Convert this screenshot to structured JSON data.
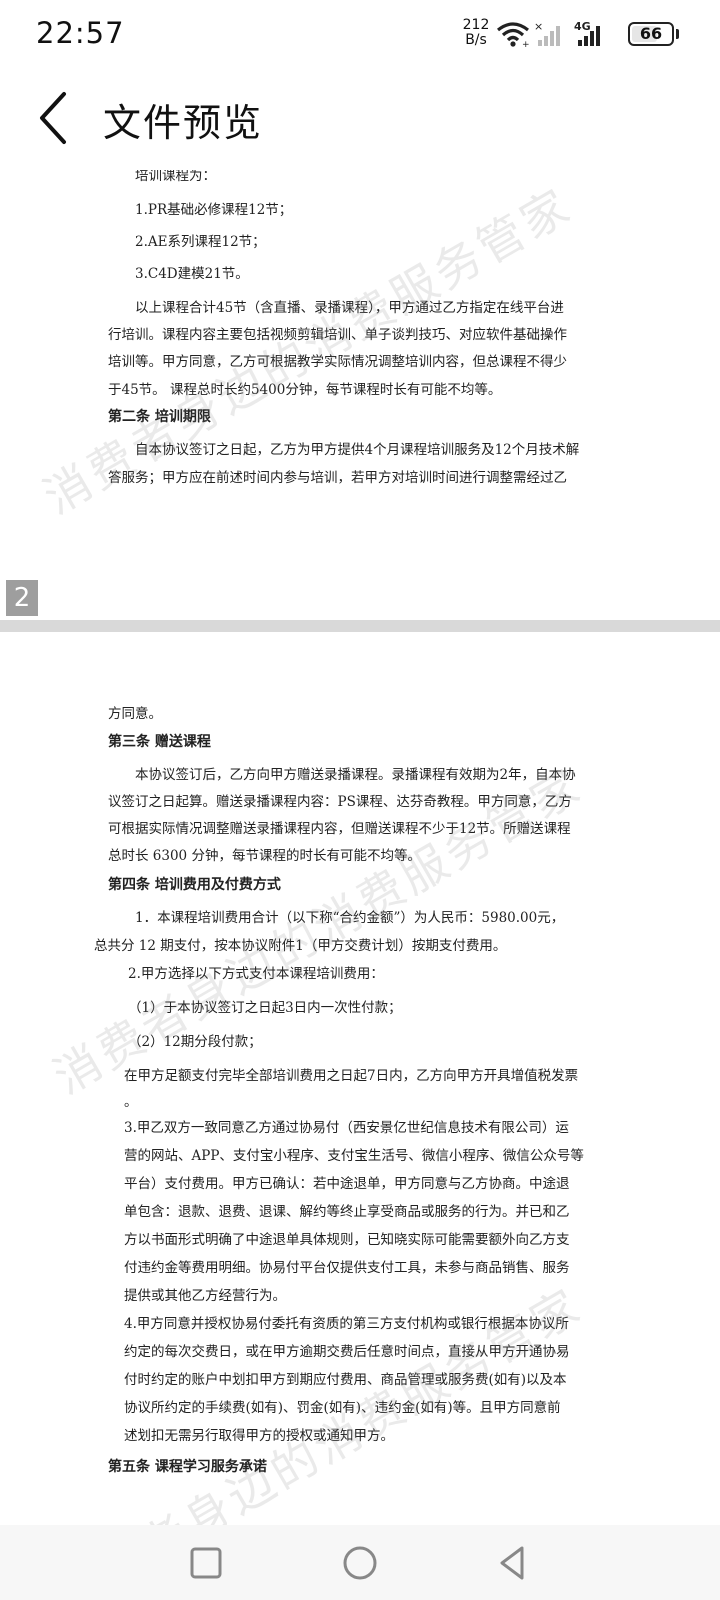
{
  "status_bar": {
    "time": "22:57",
    "net_speed_value": "212",
    "net_speed_unit": "B/s",
    "network_type": "4G",
    "battery": "66",
    "battery_level": 0.66,
    "icons": [
      "wifi-icon",
      "signal-off-icon",
      "signal-4g-icon",
      "battery-icon"
    ]
  },
  "header": {
    "title": "文件预览",
    "back_icon": "chevron-left-icon"
  },
  "viewer": {
    "page_number": "2",
    "watermark": "消费者身边的消费服务管家",
    "page1_lines": [
      "培训课程为：",
      "1.PR基础必修课程12节；",
      "2.AE系列课程12节；",
      "3.C4D建模21节。",
      "以上课程合计45节（含直播、录播课程），甲方通过乙方指定在线平台进",
      "行培训。课程内容主要包括视频剪辑培训、单子谈判技巧、对应软件基础操作",
      "培训等。甲方同意，乙方可根据教学实际情况调整培训内容，但总课程不得少",
      "于45节。 课程总时长约5400分钟，每节课程时长有可能不均等。",
      "第二条 培训期限",
      "自本协议签订之日起，乙方为甲方提供4个月课程培训服务及12个月技术解",
      "答服务；甲方应在前述时间内参与培训，若甲方对培训时间进行调整需经过乙"
    ],
    "page2_lines": [
      "方同意。",
      "第三条 赠送课程",
      "本协议签订后，乙方向甲方赠送录播课程。录播课程有效期为2年，自本协",
      "议签订之日起算。赠送录播课程内容：PS课程、达芬奇教程。甲方同意，乙方",
      "可根据实际情况调整赠送录播课程内容，但赠送课程不少于12节。所赠送课程",
      "总时长 6300 分钟，每节课程的时长有可能不均等。",
      "第四条 培训费用及付费方式",
      "1．本课程培训费用合计（以下称“合约金额”）为人民币：5980.00元，",
      "总共分      12       期支付，按本协议附件1（甲方交费计划）按期支付费用。",
      "2.甲方选择以下方式支付本课程培训费用：",
      "（1）于本协议签订之日起3日内一次性付款；",
      "（2）12期分段付款；",
      "在甲方足额支付完毕全部培训费用之日起7日内，乙方向甲方开具增值税发票",
      "。",
      "3.甲乙双方一致同意乙方通过协易付（西安景亿世纪信息技术有限公司）运",
      "营的网站、APP、支付宝小程序、支付宝生活号、微信小程序、微信公众号等",
      "平台）支付费用。甲方已确认：若中途退单，甲方同意与乙方协商。中途退",
      "单包含：退款、退费、退课、解约等终止享受商品或服务的行为。并已和乙",
      "方以书面形式明确了中途退单具体规则，已知晓实际可能需要额外向乙方支",
      "付违约金等费用明细。协易付平台仅提供支付工具，未参与商品销售、服务",
      "提供或其他乙方经营行为。",
      "4.甲方同意并授权协易付委托有资质的第三方支付机构或银行根据本协议所",
      "约定的每次交费日，或在甲方逾期交费后任意时间点，直接从甲方开通协易",
      "付时约定的账户中划扣甲方到期应付费用、商品管理或服务费(如有)以及本",
      "协议所约定的手续费(如有)、罚金(如有)、违约金(如有)等。且甲方同意前",
      "述划扣无需另行取得甲方的授权或通知甲方。",
      "第五条 课程学习服务承诺"
    ]
  },
  "nav_bar": {
    "buttons": [
      "square-recents-icon",
      "circle-home-icon",
      "triangle-back-icon"
    ]
  }
}
